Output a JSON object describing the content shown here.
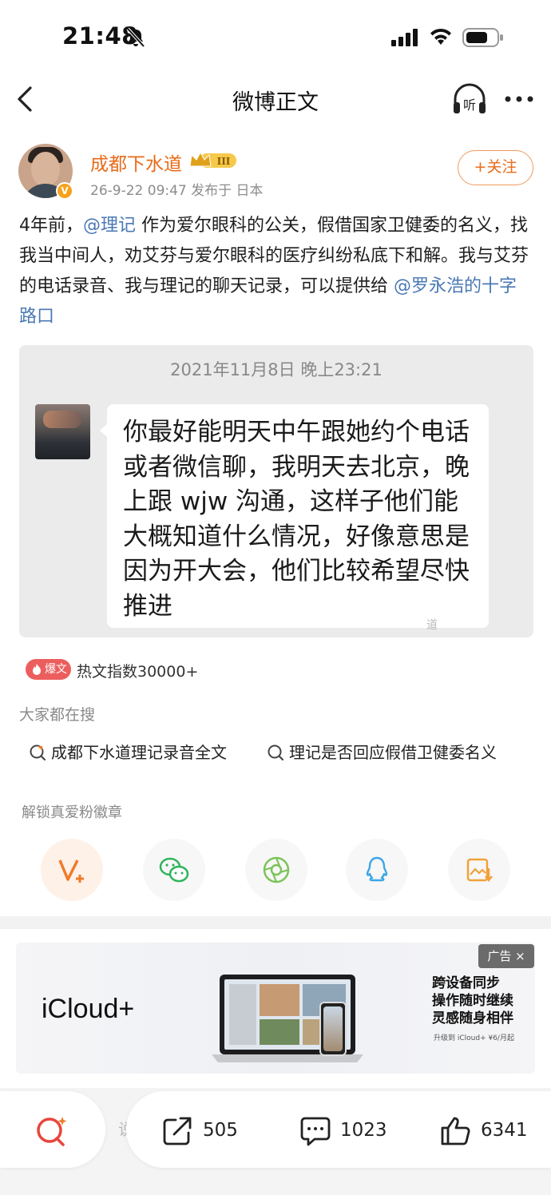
{
  "status_bar": {
    "time": "21:48"
  },
  "nav": {
    "title": "微博正文",
    "listen_label": "听"
  },
  "author": {
    "name": "成都下水道",
    "badge_level": "III",
    "verified_mark": "V",
    "meta": "26-9-22 09:47  发布于 日本",
    "follow_label": "+关注"
  },
  "post": {
    "segments": [
      {
        "text": "4年前，",
        "mention": false
      },
      {
        "text": "@理记",
        "mention": true
      },
      {
        "text": " 作为爱尔眼科的公关，假借国家卫健委的名义，找我当中间人，劝艾芬与爱尔眼科的医疗纠纷私底下和解。我与艾芬的电话录音、我与理记的聊天记录，可以提供给 ",
        "mention": false
      },
      {
        "text": "@罗永浩的十字路口",
        "mention": true
      }
    ]
  },
  "chat_image": {
    "date": "2021年11月8日 晚上23:21",
    "message": "你最好能明天中午跟她约个电话或者微信聊，我明天去北京，晚上跟 wjw 沟通，这样子他们能大概知道什么情况，好像意思是因为开大会，他们比较希望尽快推进",
    "watermark": "道"
  },
  "hot": {
    "badge": "爆文",
    "text": "热文指数30000+"
  },
  "searches": {
    "title": "大家都在搜",
    "items": [
      "成都下水道理记录音全文",
      "理记是否回应假借卫健委名义"
    ]
  },
  "unlock": {
    "title": "解锁真爱粉徽章"
  },
  "ad": {
    "tag": "广告 ×",
    "brand": "iCloud+",
    "lines": [
      "跨设备同步",
      "操作随时继续",
      "灵感随身相伴"
    ],
    "fine_print": "升级到 iCloud+ ¥6/月起"
  },
  "bottom": {
    "comment_stub": "说",
    "reposts": "505",
    "comments": "1023",
    "likes": "6341"
  },
  "colors": {
    "accent_orange": "#e86b1b",
    "mention_blue": "#4a78b4",
    "hot_red": "#ec5e5e"
  }
}
